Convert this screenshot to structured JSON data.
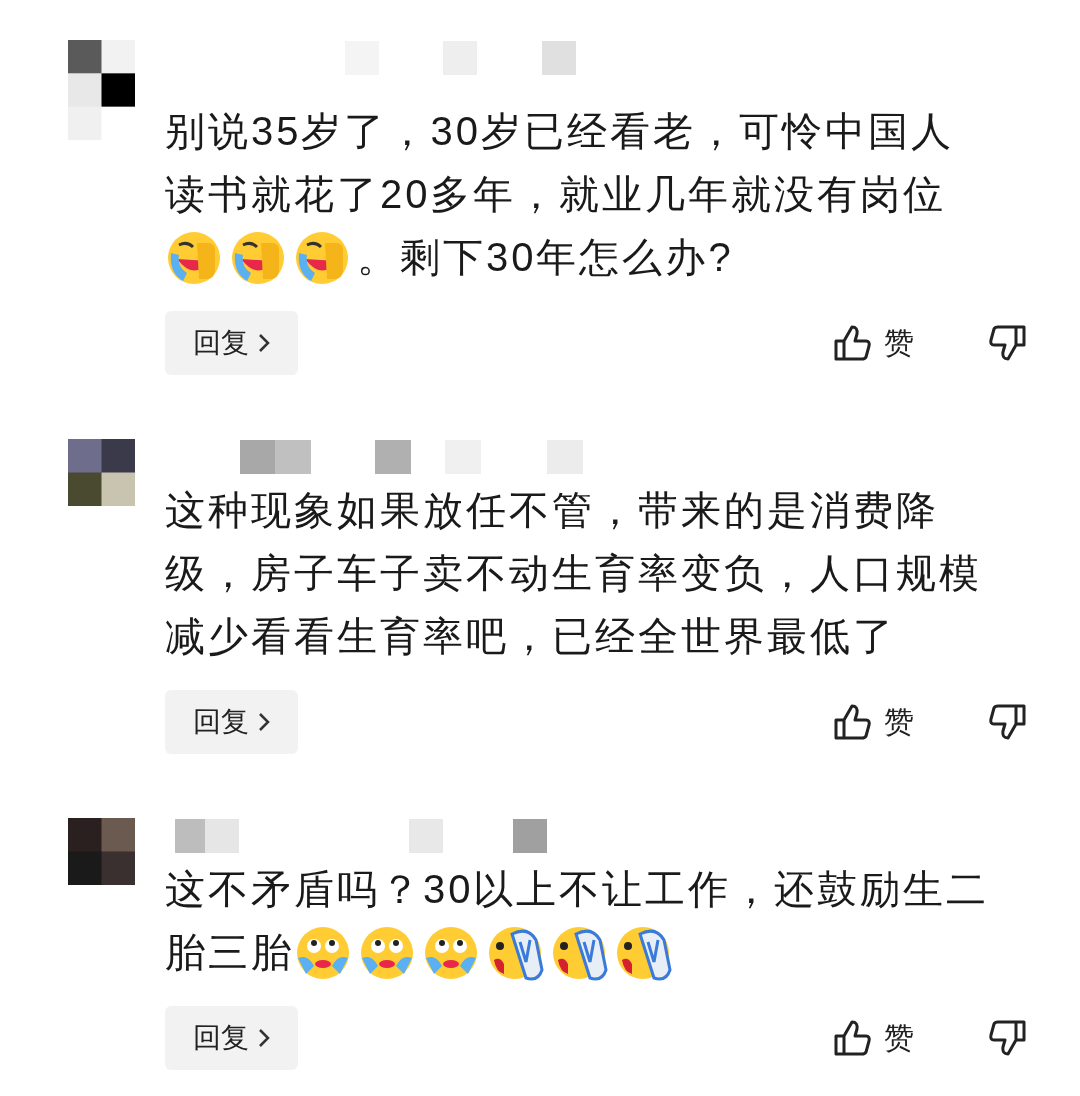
{
  "comments": [
    {
      "lines": [
        [
          {
            "kind": "text",
            "text": "别说35岁了，30岁已经看老，可怜中国人"
          }
        ],
        [
          {
            "kind": "text",
            "text": "读书就花了20多年，就业几年就没有岗位"
          }
        ],
        [
          {
            "kind": "laughing-tears"
          },
          {
            "kind": "laughing-tears"
          },
          {
            "kind": "laughing-tears"
          },
          {
            "kind": "text",
            "text": "。剩下30年怎么办?"
          }
        ]
      ],
      "reply": "回复",
      "like": "赞"
    },
    {
      "lines": [
        [
          {
            "kind": "text",
            "text": "这种现象如果放任不管，带来的是消费降"
          }
        ],
        [
          {
            "kind": "text",
            "text": "级，房子车子卖不动生育率变负，人口规模"
          }
        ],
        [
          {
            "kind": "text",
            "text": "减少看看生育率吧，已经全世界最低了"
          }
        ]
      ],
      "reply": "回复",
      "like": "赞"
    },
    {
      "lines": [
        [
          {
            "kind": "text",
            "text": "这不矛盾吗？30以上不让工作，还鼓励生二"
          }
        ],
        [
          {
            "kind": "text",
            "text": "胎三胎"
          },
          {
            "kind": "teary"
          },
          {
            "kind": "teary"
          },
          {
            "kind": "teary"
          },
          {
            "kind": "slipper"
          },
          {
            "kind": "slipper"
          },
          {
            "kind": "slipper"
          }
        ]
      ],
      "reply": "回复",
      "like": "赞"
    }
  ]
}
